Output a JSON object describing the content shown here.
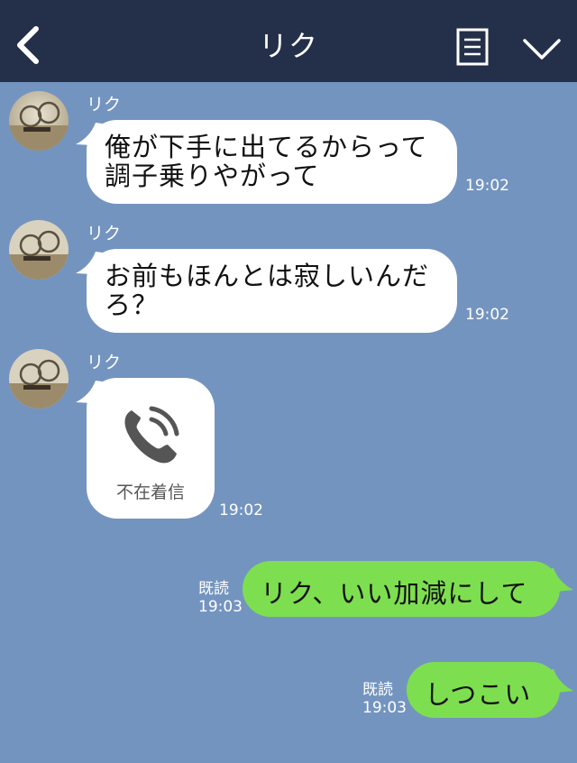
{
  "header": {
    "title": "リク",
    "back_icon": "chevron-left-icon",
    "menu_icon": "document-menu-icon",
    "collapse_icon": "chevron-down-icon"
  },
  "messages": [
    {
      "sender": "リク",
      "text": "俺が下手に出てるからって\n調子乗りやがって",
      "time": "19:02"
    },
    {
      "sender": "リク",
      "text": "お前もほんとは寂しいんだ\nろ？",
      "time": "19:02"
    },
    {
      "sender": "リク",
      "type": "missed-call",
      "icon": "phone-icon",
      "label": "不在着信",
      "time": "19:02"
    }
  ],
  "outgoing": [
    {
      "text": "リク、いい加減にして",
      "read": "既読",
      "time": "19:03"
    },
    {
      "text": "しつこい",
      "read": "既読",
      "time": "19:03"
    }
  ],
  "colors": {
    "background": "#7494c0",
    "header": "#243049",
    "outgoing_bubble": "#7ddf4f",
    "incoming_bubble": "#ffffff"
  }
}
